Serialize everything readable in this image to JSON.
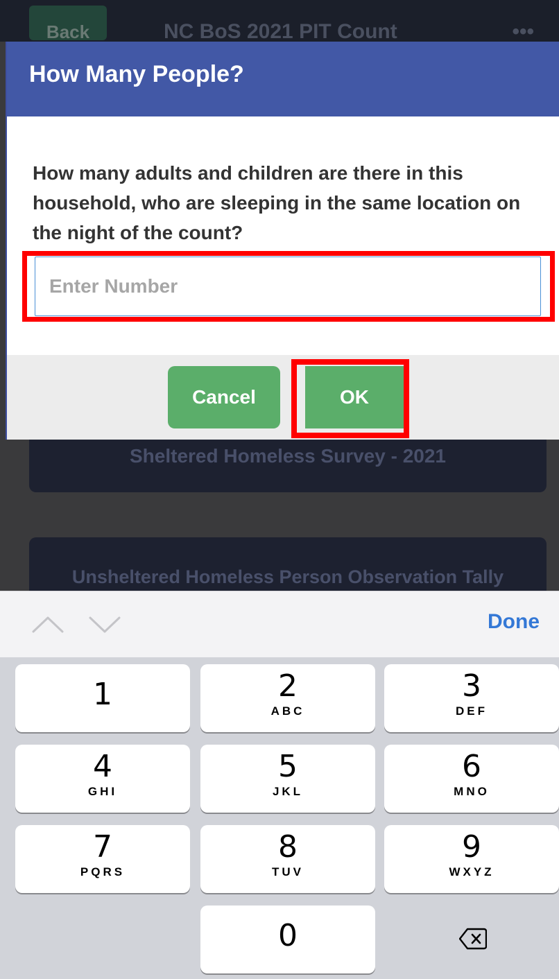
{
  "background": {
    "back_label": "Back",
    "app_title": "NC BoS 2021 PIT Count",
    "menu_label": "•••",
    "cards": [
      {
        "label": "Sheltered Homeless Survey - 2021"
      },
      {
        "label": "Unsheltered Homeless Person Observation Tally"
      }
    ]
  },
  "dialog": {
    "title": "How Many People?",
    "question": "How many adults and children are there in this household, who are sleeping in the same location on the night of the count?",
    "input": {
      "value": "",
      "placeholder": "Enter Number"
    },
    "cancel_label": "Cancel",
    "ok_label": "OK"
  },
  "keyboard_bar": {
    "done_label": "Done",
    "up_icon": "chevron-up-icon",
    "down_icon": "chevron-down-icon"
  },
  "keypad": {
    "keys": [
      {
        "digit": "1",
        "letters": ""
      },
      {
        "digit": "2",
        "letters": "ABC"
      },
      {
        "digit": "3",
        "letters": "DEF"
      },
      {
        "digit": "4",
        "letters": "GHI"
      },
      {
        "digit": "5",
        "letters": "JKL"
      },
      {
        "digit": "6",
        "letters": "MNO"
      },
      {
        "digit": "7",
        "letters": "PQRS"
      },
      {
        "digit": "8",
        "letters": "TUV"
      },
      {
        "digit": "9",
        "letters": "WXYZ"
      },
      {
        "digit": "0",
        "letters": ""
      }
    ],
    "backspace_icon": "backspace-icon"
  },
  "colors": {
    "dialog_header": "#4258a6",
    "button_green": "#5bae6a",
    "highlight_red": "#ff0000",
    "done_blue": "#3478d6"
  }
}
